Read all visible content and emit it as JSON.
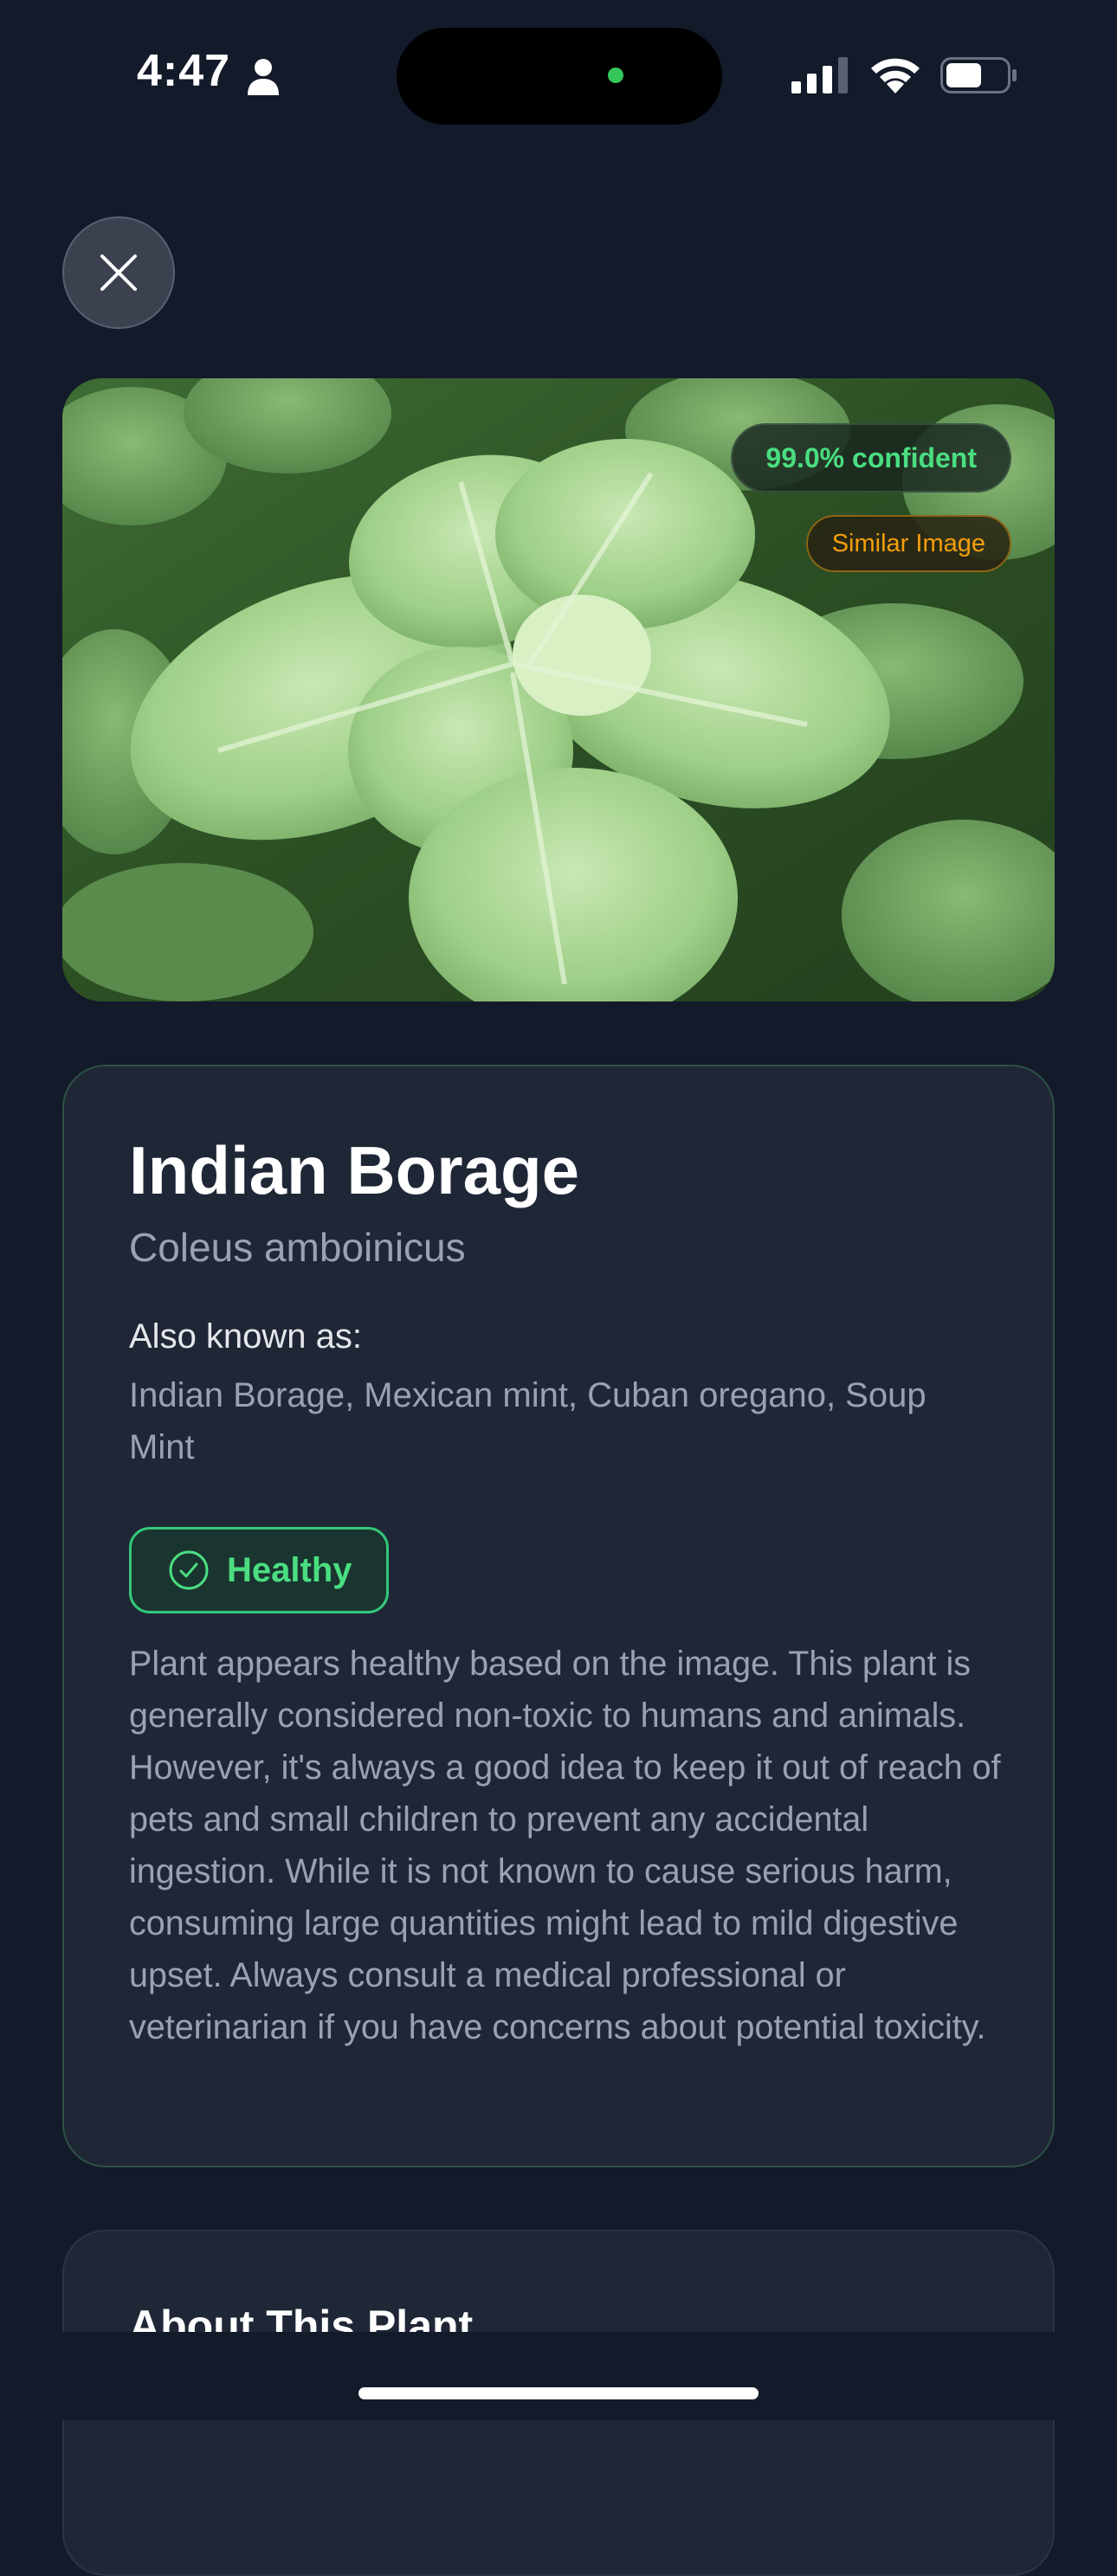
{
  "status_bar": {
    "time": "4:47",
    "icons": [
      "person-icon",
      "signal-icon",
      "wifi-icon",
      "battery-icon"
    ]
  },
  "close_button": {
    "icon": "close-icon"
  },
  "photo": {
    "confidence_label": "99.0% confident",
    "similar_label": "Similar Image"
  },
  "plant": {
    "common_name": "Indian Borage",
    "scientific_name": "Coleus amboinicus",
    "aka_label": "Also known as:",
    "aka_value": "Indian Borage, Mexican mint, Cuban oregano, Soup Mint",
    "health_status": "Healthy",
    "health_icon": "check-circle-icon",
    "description": "Plant appears healthy based on the image. This plant is generally considered non-toxic to humans and animals. However, it's always a good idea to keep it out of reach of pets and small children to prevent any accidental ingestion. While it is not known to cause serious harm, consuming large quantities might lead to mild digestive upset. Always consult a medical professional or veterinarian if you have concerns about potential toxicity."
  },
  "about": {
    "title": "About This Plant"
  },
  "colors": {
    "background": "#131a2a",
    "card": "#1f2736",
    "accent_green": "#4ade80",
    "accent_orange": "#f59e0b"
  }
}
